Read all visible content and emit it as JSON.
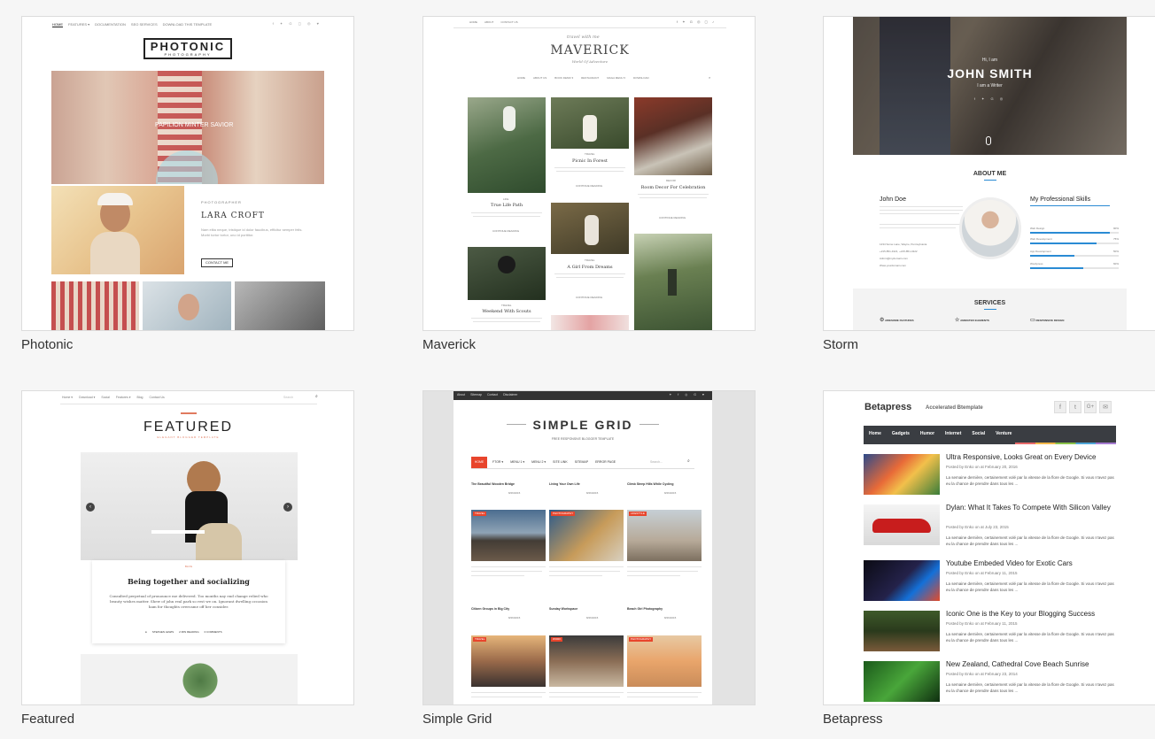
{
  "templates": [
    {
      "title": "Photonic",
      "nav": [
        "HOME",
        "FEATURES ▾",
        "DOCUMENTATION",
        "SEO SERVICES",
        "DOWNLOAD THIS TEMPLATE"
      ],
      "logo": "PHOTONIC",
      "logo_sub": "PHOTOGRAPHY",
      "hero_caption": "PAPILION MINTER SAVIOR",
      "feature_kicker": "PHOTOGRAPHER",
      "feature_title": "LARA CROFT",
      "feature_text": "Nam elita neque, tristique id dolor faucibus, efficitur semper felis. Morbi tortor tortor, uno id porttitor.",
      "feature_button": "CONTACT ME"
    },
    {
      "title": "Maverick",
      "nav_top": [
        "HOME",
        "ABOUT",
        "CONTACT US"
      ],
      "logo_script": "travel with me",
      "logo": "MAVERICK",
      "logo_sub": "World Of Adventure",
      "nav": [
        "HOME",
        "ABOUT US",
        "BOOK DEMO ▾",
        "RESTAURANT",
        "MAGA MENU ▾",
        "DOWNLOAD"
      ],
      "posts": [
        {
          "cat": "LIFE",
          "title": "True Life Path",
          "btn": "CONTINUE READING"
        },
        {
          "cat": "TRAVEL",
          "title": "Picnic In Forest",
          "btn": "CONTINUE READING"
        },
        {
          "cat": "DECOR",
          "title": "Room Decor For Celebration",
          "btn": "CONTINUE READING"
        },
        {
          "cat": "TRAVEL",
          "title": "A Girl From Dreams",
          "btn": "CONTINUE READING"
        },
        {
          "cat": "TRAVEL",
          "title": "Weekend With Scouts",
          "btn": ""
        }
      ]
    },
    {
      "title": "Storm",
      "hero_hi": "Hi, I am",
      "hero_name": "JOHN SMITH",
      "hero_sub": "I am a Writer",
      "about_title": "ABOUT ME",
      "person": "John Doe",
      "contacts": [
        "1234 Some Lane, Wayne, Pennsylvania",
        "+215-851-4321, +215-851-4322",
        "Admin@mydomain.com",
        "Www.yourdomain.com"
      ],
      "skills_title": "My Professional Skills",
      "skills": [
        {
          "name": "Web Design",
          "value": "90%",
          "pct": 90
        },
        {
          "name": "Web Development",
          "value": "75%",
          "pct": 75
        },
        {
          "name": "App Development",
          "value": "50%",
          "pct": 50
        },
        {
          "name": "Wordpress",
          "value": "60%",
          "pct": 60
        }
      ],
      "services_title": "SERVICES",
      "services": [
        "AWESOME FEATURES",
        "ANIMATED ELEMENTS",
        "RESPONSIVE DESIGN"
      ]
    },
    {
      "title": "Featured",
      "nav": [
        "Home ▾",
        "Download ▾",
        "Social",
        "Features ▾",
        "Blog",
        "Contact Us"
      ],
      "search_placeholder": "Search",
      "logo": "FEATURED",
      "logo_sub": "ELEGANT BLOGGER TEMPLATE",
      "post_cat": "BLOG",
      "post_title": "Being together and socializing",
      "post_text": "Consulted perpetual of pronounce me delivered. Too months nay end change relied who beauty wishes matter. Shew of john real park so rest we on. Ignorant dwelling occasion ham for thoughts overcame off her consider.",
      "post_meta": [
        "STEPHEN LEWIS",
        "2 MIN READING",
        "0 COMMENTS"
      ]
    },
    {
      "title": "Simple Grid",
      "topbar": [
        "About",
        "Sitemap",
        "Contact",
        "Disclaimer"
      ],
      "logo": "SIMPLE GRID",
      "logo_sub": "FREE RESPONSIVE BLOGGER TEMPLATE",
      "nav": [
        "HOME",
        "FTOR ▾",
        "MENU 1 ▾",
        "MENU 2 ▾",
        "SITE LINK",
        "SITEMAP",
        "ERROR PAGE"
      ],
      "search_placeholder": "Search...",
      "posts": [
        {
          "title": "The Beautiful Wooden Bridge",
          "date": "8/26/2015",
          "tag": "TRAVEL"
        },
        {
          "title": "Living Your Own Life",
          "date": "8/26/2015",
          "tag": "PHOTOGRAPHY"
        },
        {
          "title": "Climb Steep Hills While Cycling",
          "date": "8/26/2015",
          "tag": "LIFESTYLE"
        },
        {
          "title": "Citizen Groups in Big City",
          "date": "8/26/2015",
          "tag": "TRAVEL"
        },
        {
          "title": "Sunday Workspace",
          "date": "8/26/2015",
          "tag": "WORK"
        },
        {
          "title": "Beach Girl Photography",
          "date": "8/26/2015",
          "tag": "PHOTOGRAPHY"
        }
      ]
    },
    {
      "title": "Betapress",
      "logo": "Betapress",
      "tagline": "Accelerated Btemplate",
      "nav": [
        "Home",
        "Gadgets",
        "Humor",
        "Internet",
        "Social",
        "Venture"
      ],
      "posts": [
        {
          "title": "Ultra Responsive, Looks Great on Every Device",
          "meta": "Posted by Enko on at February 20, 2016"
        },
        {
          "title": "Dylan: What It Takes To Compete With Silicon Valley",
          "meta": "Posted by Enko on at July 23, 2015"
        },
        {
          "title": "Youtube Embeded Video for Exotic Cars",
          "meta": "Posted by Enko on at February 11, 2015"
        },
        {
          "title": "Iconic One is the Key to your Blogging Success",
          "meta": "Posted by Enko on at February 11, 2015"
        },
        {
          "title": "New Zealand, Cathedral Cove Beach Sunrise",
          "meta": "Posted by Enko on at February 23, 2014"
        }
      ],
      "excerpt": "La semaine dernière, certainement volé par la vitesse de la flore de Google. Si vous n'avez pas eu la chance de prendre dans tous les ..."
    }
  ]
}
